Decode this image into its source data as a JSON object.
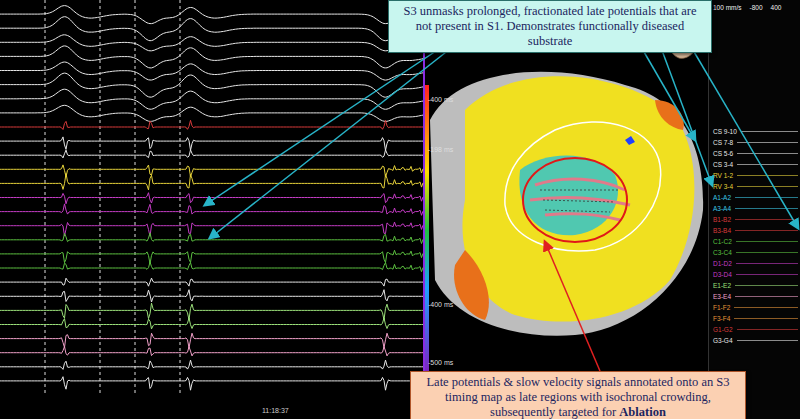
{
  "callouts": [
    {
      "text": "S3 unmasks prolonged, fractionated late potentials that are not present in S1. Demonstrates functionally diseased substrate",
      "color": "#c8f6ef"
    },
    {
      "text": "Late potentials & slow velocity signals annotated onto an S3 timing map as late regions with isochronal crowding, subsequently targeted for ",
      "emphasis": "Ablation",
      "color": "#fbd0b2"
    }
  ],
  "electrograms": {
    "time_label": "11:18:37",
    "traces": [
      {
        "color": "#e6e6e6"
      },
      {
        "color": "#e6e6e6"
      },
      {
        "color": "#e6e6e6"
      },
      {
        "color": "#e6e6e6"
      },
      {
        "color": "#e6e6e6"
      },
      {
        "color": "#e6e6e6"
      },
      {
        "color": "#e6e6e6"
      },
      {
        "color": "#e6e6e6"
      },
      {
        "color": "#d83a3a"
      },
      {
        "color": "#e6e6e6"
      },
      {
        "color": "#e6e6e6"
      },
      {
        "color": "#e6d23a"
      },
      {
        "color": "#e6d23a"
      },
      {
        "color": "#c43cc4"
      },
      {
        "color": "#c43cc4"
      },
      {
        "color": "#c43cc4"
      },
      {
        "color": "#5cc040"
      },
      {
        "color": "#5cc040"
      },
      {
        "color": "#5cc040"
      },
      {
        "color": "#e6e6e6"
      },
      {
        "color": "#e6e6e6"
      },
      {
        "color": "#9be07a"
      },
      {
        "color": "#9be07a"
      },
      {
        "color": "#f0a0c8"
      },
      {
        "color": "#f0a0c8"
      },
      {
        "color": "#e6e6e6"
      },
      {
        "color": "#e6e6e6"
      }
    ]
  },
  "map": {
    "scale_labels": [
      "-400 ms",
      "-198 ms",
      "-400 ms",
      "-500 ms"
    ]
  },
  "channels": {
    "header": [
      "100 mm/s",
      "-800",
      "400"
    ],
    "items": [
      {
        "label": "CS 9-10",
        "color": "#e6e6e6"
      },
      {
        "label": "CS 7-8",
        "color": "#e6e6e6"
      },
      {
        "label": "CS 5-6",
        "color": "#e6e6e6"
      },
      {
        "label": "CS 3-4",
        "color": "#e6e6e6"
      },
      {
        "label": "RV 1-2",
        "color": "#e6d23a"
      },
      {
        "label": "RV 3-4",
        "color": "#e6d23a"
      },
      {
        "label": "A1-A2",
        "color": "#3cc8e6"
      },
      {
        "label": "A3-A4",
        "color": "#3cc8e6"
      },
      {
        "label": "B1-B2",
        "color": "#d83a3a"
      },
      {
        "label": "B3-B4",
        "color": "#d83a3a"
      },
      {
        "label": "C1-C2",
        "color": "#5cc040"
      },
      {
        "label": "C3-C4",
        "color": "#5cc040"
      },
      {
        "label": "D1-D2",
        "color": "#c43cc4"
      },
      {
        "label": "D3-D4",
        "color": "#c43cc4"
      },
      {
        "label": "E1-E2",
        "color": "#9be07a"
      },
      {
        "label": "E3-E4",
        "color": "#f0a0c8"
      },
      {
        "label": "F1-F2",
        "color": "#e6943a"
      },
      {
        "label": "F3-F4",
        "color": "#e6943a"
      },
      {
        "label": "G1-G2",
        "color": "#d83a3a"
      },
      {
        "label": "G3-G4",
        "color": "#e6e6e6"
      }
    ]
  }
}
